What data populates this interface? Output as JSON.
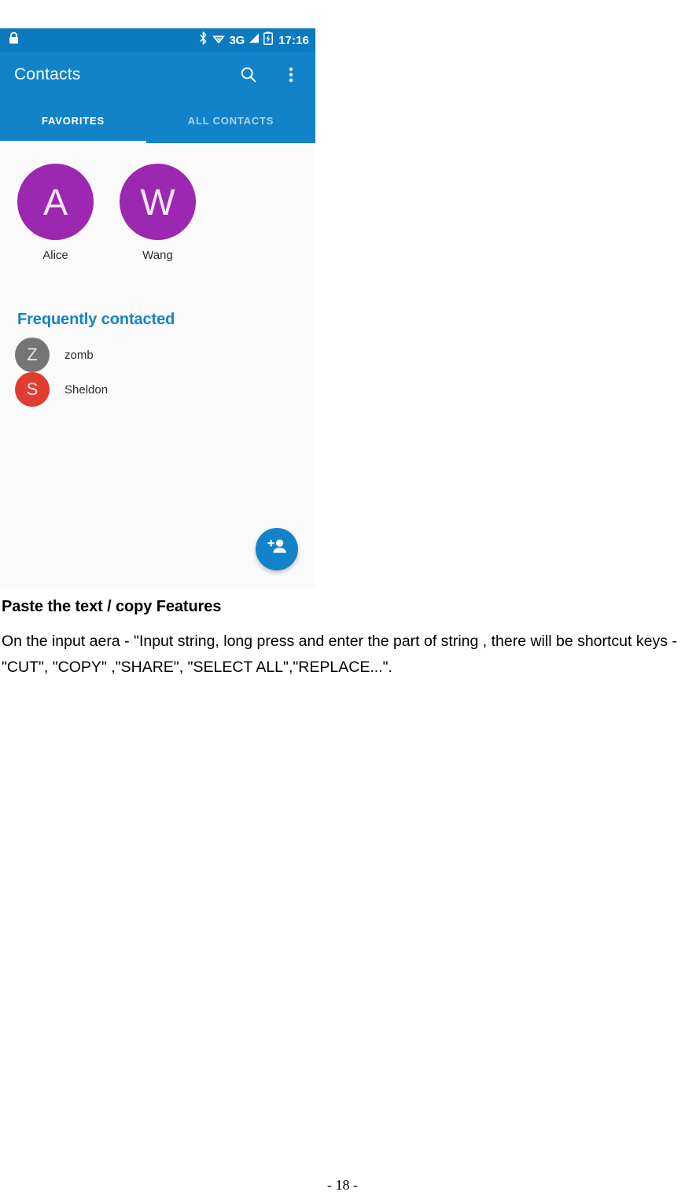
{
  "phone": {
    "status_bar": {
      "lock_icon": "lock-icon",
      "bluetooth_icon": "bluetooth-icon",
      "wifi_icon": "wifi-icon",
      "network_label": "3G",
      "signal_icon": "signal-bars-icon",
      "battery_icon": "battery-charging-icon",
      "clock": "17:16"
    },
    "app_bar": {
      "title": "Contacts",
      "search_icon": "search-icon",
      "overflow_icon": "overflow-menu-icon"
    },
    "tabs": [
      {
        "label": "FAVORITES",
        "active": true
      },
      {
        "label": "ALL CONTACTS",
        "active": false
      }
    ],
    "favorites": [
      {
        "initial": "A",
        "name": "Alice",
        "color": "#9c27b0"
      },
      {
        "initial": "W",
        "name": "Wang",
        "color": "#9c27b0"
      }
    ],
    "frequently_contacted": {
      "header": "Frequently contacted",
      "items": [
        {
          "initial": "Z",
          "name": "zomb",
          "color": "#757575"
        },
        {
          "initial": "S",
          "name": "Sheldon",
          "color": "#e03c31"
        }
      ]
    },
    "fab": {
      "icon": "add-person-icon"
    },
    "colors": {
      "status_bar": "#0b7ac0",
      "app_bar": "#1283c8",
      "accent": "#1283c8",
      "avatar_purple": "#9c27b0",
      "avatar_gray": "#757575",
      "avatar_red": "#e03c31",
      "content_bg": "#fafafa"
    }
  },
  "document": {
    "heading": "Paste the text / copy Features",
    "paragraph": "On the input aera - \"Input string, long press and enter the part of string , there will be shortcut keys - \"CUT\", \"COPY\" ,\"SHARE\", \"SELECT ALL\",\"REPLACE...\".",
    "page_number": "- 18 -"
  }
}
